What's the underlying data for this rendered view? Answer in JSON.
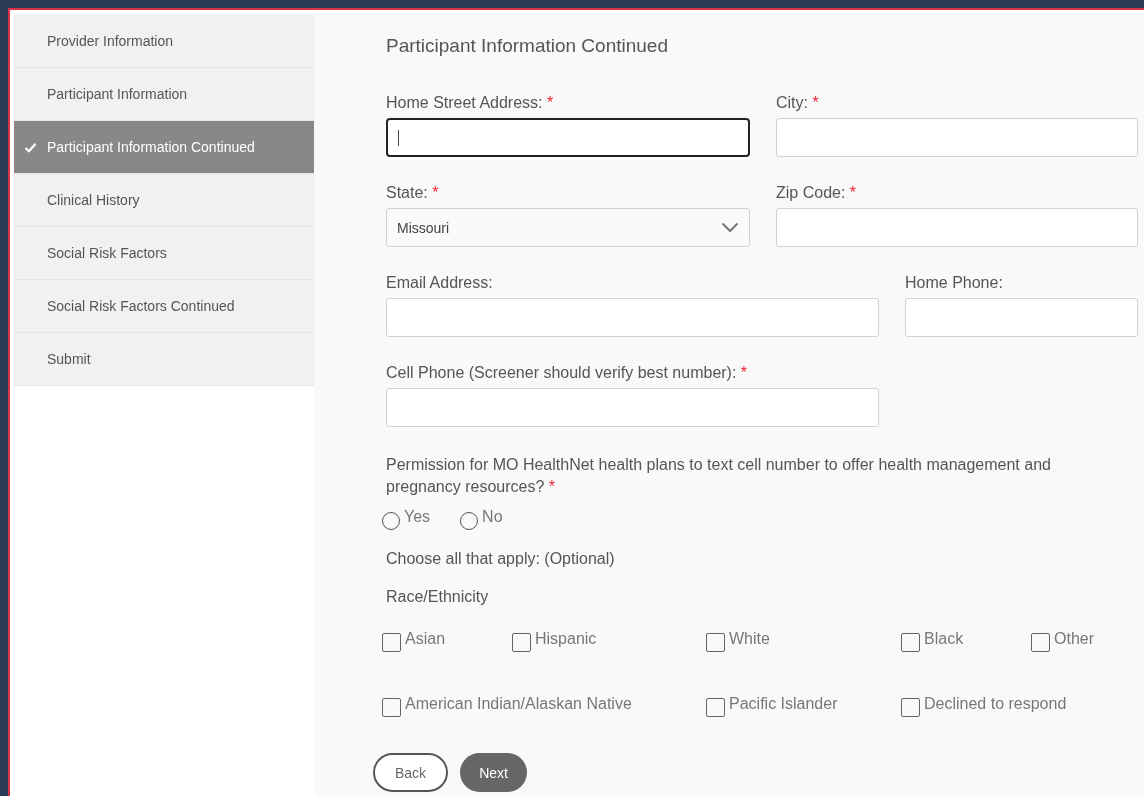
{
  "sidebar": {
    "items": [
      {
        "label": "Provider Information",
        "selected": false,
        "done": false
      },
      {
        "label": "Participant Information",
        "selected": false,
        "done": false
      },
      {
        "label": "Participant Information Continued",
        "selected": true,
        "done": true
      },
      {
        "label": "Clinical History",
        "selected": false,
        "done": false
      },
      {
        "label": "Social Risk Factors",
        "selected": false,
        "done": false
      },
      {
        "label": "Social Risk Factors Continued",
        "selected": false,
        "done": false
      },
      {
        "label": "Submit",
        "selected": false,
        "done": false
      }
    ]
  },
  "form": {
    "title": "Participant Information Continued",
    "rows": [
      {
        "kind": "pair",
        "fields": [
          {
            "kind": "text",
            "label": "Home Street Address:",
            "required": "*",
            "focused": true
          },
          {
            "kind": "text",
            "label": "City:",
            "required": "*",
            "focused": false
          }
        ]
      },
      {
        "kind": "pair",
        "fields": [
          {
            "kind": "select",
            "label": "State:",
            "required": "*",
            "value": "Missouri"
          },
          {
            "kind": "text",
            "label": "Zip Code:",
            "required": "*",
            "focused": false
          }
        ]
      },
      {
        "kind": "wide",
        "fields": [
          {
            "kind": "text",
            "label": "Email Address:",
            "focused": false
          },
          {
            "kind": "text",
            "label": "Home Phone:",
            "focused": false
          }
        ]
      },
      {
        "kind": "single",
        "fields": [
          {
            "kind": "text",
            "label": "Cell Phone (Screener should verify best number):",
            "required": "*",
            "focused": false
          }
        ]
      }
    ],
    "permission": {
      "question": "Permission for MO HealthNet health plans to text cell number to offer health management and pregnancy resources?",
      "required": "*",
      "options": [
        {
          "label": "Yes",
          "selected": false
        },
        {
          "label": "No",
          "selected": false
        }
      ]
    },
    "choose_note": "Choose all that apply: (Optional)",
    "race": {
      "heading": "Race/Ethnicity",
      "options": [
        {
          "label": "Asian",
          "checked": false
        },
        {
          "label": "Hispanic",
          "checked": false
        },
        {
          "label": "White",
          "checked": false
        },
        {
          "label": "Black",
          "checked": false
        },
        {
          "label": "Other",
          "checked": false
        },
        {
          "label": "American Indian/Alaskan Native",
          "checked": false
        },
        {
          "label": "Pacific Islander",
          "checked": false
        },
        {
          "label": "Declined to respond",
          "checked": false
        }
      ]
    },
    "buttons": [
      {
        "kind": "secondary",
        "label": "Back"
      },
      {
        "kind": "primary",
        "label": "Next"
      }
    ]
  }
}
